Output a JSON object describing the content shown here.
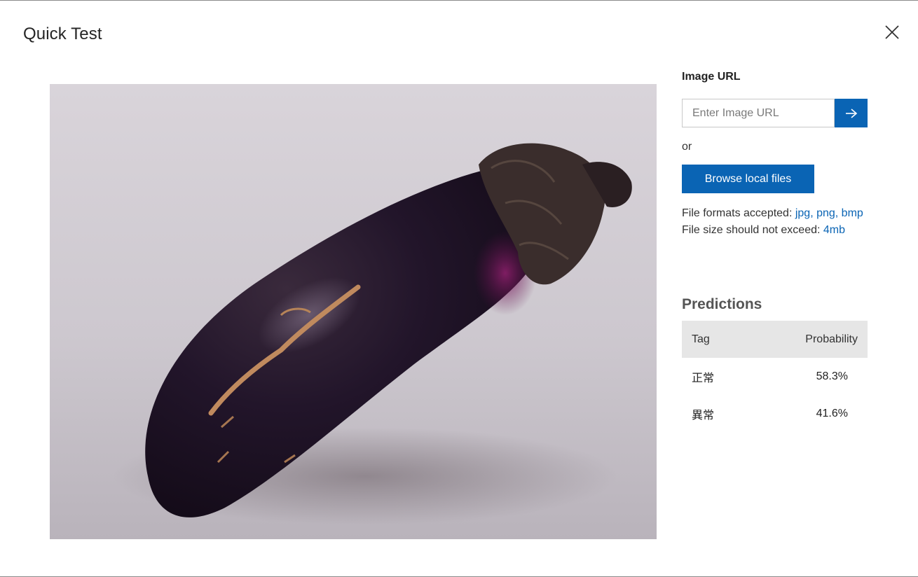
{
  "dialog": {
    "title": "Quick Test"
  },
  "image_url": {
    "label": "Image URL",
    "placeholder": "Enter Image URL",
    "submit_icon": "arrow-right-icon"
  },
  "or_text": "or",
  "browse": {
    "label": "Browse local files"
  },
  "file_info": {
    "formats_prefix": "File formats accepted: ",
    "formats_links": "jpg, png, bmp",
    "size_prefix": "File size should not exceed: ",
    "size_link": "4mb"
  },
  "predictions": {
    "title": "Predictions",
    "columns": [
      "Tag",
      "Probability"
    ],
    "rows": [
      {
        "tag": "正常",
        "probability": "58.3%"
      },
      {
        "tag": "異常",
        "probability": "41.6%"
      }
    ]
  },
  "colors": {
    "accent": "#0a64b4",
    "header_bg": "#e6e6e6"
  },
  "icons": {
    "close": "close-icon",
    "submit": "arrow-right-icon"
  }
}
